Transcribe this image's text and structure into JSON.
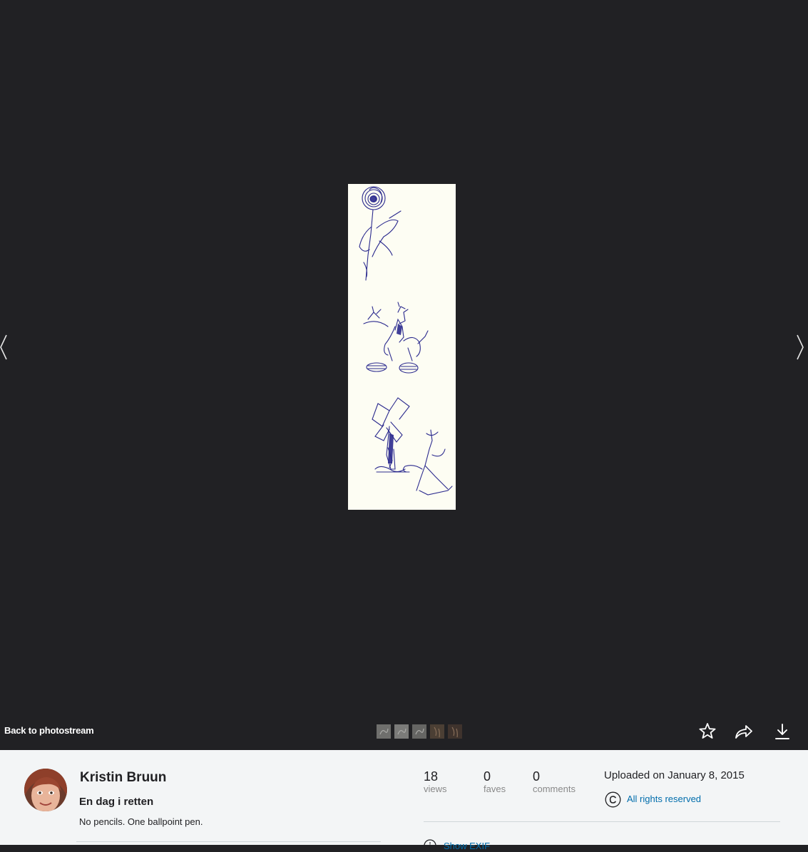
{
  "viewer": {
    "back_label": "Back to photostream",
    "prev_icon": "chevron-left-icon",
    "next_icon": "chevron-right-icon",
    "filmstrip": [
      {
        "name": "thumb-1",
        "color": "#8a8a86"
      },
      {
        "name": "thumb-2",
        "color": "#9a9a96"
      },
      {
        "name": "thumb-3",
        "color": "#7c7c78"
      },
      {
        "name": "thumb-4",
        "color": "#5a4a3a"
      },
      {
        "name": "thumb-5",
        "color": "#4a3a30"
      }
    ],
    "actions": {
      "fave_icon": "star-icon",
      "share_icon": "share-icon",
      "download_icon": "download-icon"
    }
  },
  "info": {
    "author_name": "Kristin Bruun",
    "photo_title": "En dag i retten",
    "photo_description": "No pencils. One ballpoint pen.",
    "stats": {
      "views": "18",
      "views_label": "views",
      "faves": "0",
      "faves_label": "faves",
      "comments": "0",
      "comments_label": "comments"
    },
    "uploaded": "Uploaded on January 8, 2015",
    "license": "All rights reserved",
    "exif_link": "Show EXIF"
  },
  "colors": {
    "background": "#212124",
    "panel": "#f3f5f6",
    "link": "#006dac",
    "ink": "#2a2a8c"
  }
}
